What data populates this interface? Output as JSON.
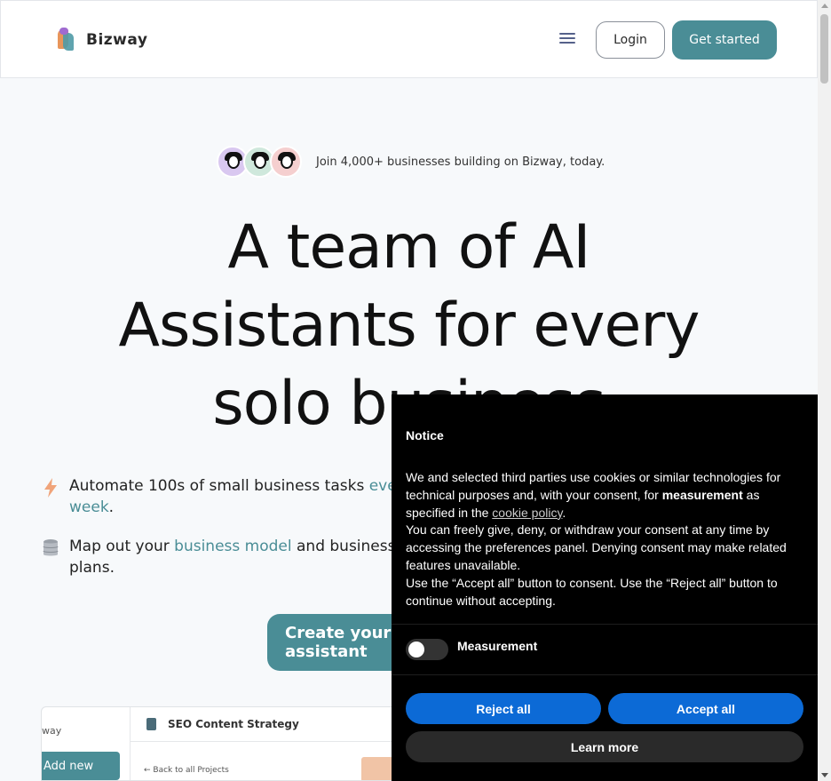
{
  "header": {
    "brand": "Bizway",
    "login_label": "Login",
    "get_started_label": "Get started"
  },
  "hero": {
    "social_proof": "Join 4,000+ businesses building on Bizway, today.",
    "headline_line1": "A team of AI",
    "headline_line2": "Assistants for every",
    "headline_line3": "solo business",
    "features": [
      {
        "icon": "bolt-icon",
        "text_before": "Automate 100s of small business tasks ",
        "highlight": "every week",
        "text_after": "."
      },
      {
        "icon": "database-icon",
        "text_before": "Map out your ",
        "highlight": "business model",
        "text_after": " and business plans."
      }
    ],
    "cta_label": "Create your first AI assistant"
  },
  "preview": {
    "sidebar_partial": "way",
    "add_new_label": "Add new",
    "project_title": "SEO Content Strategy",
    "back_link": "← Back to all Projects"
  },
  "notice": {
    "title": "Notice",
    "p1_before": "We and selected third parties use cookies or similar technologies for technical purposes and, with your consent, for ",
    "p1_bold": "measurement",
    "p1_middle": " as specified in the ",
    "p1_link": "cookie policy",
    "p1_end": ".",
    "p2": "You can freely give, deny, or withdraw your consent at any time by accessing the preferences panel. Denying consent may make related features unavailable.",
    "p3": "Use the “Accept all” button to consent. Use the “Reject all” button to continue without accepting.",
    "toggle_label": "Measurement",
    "toggle_on": false,
    "reject_label": "Reject all",
    "accept_label": "Accept all",
    "learn_more_label": "Learn more"
  },
  "colors": {
    "accent": "#4a8d96",
    "cookie_button": "#0c6ad6",
    "notice_bg": "#000000"
  }
}
